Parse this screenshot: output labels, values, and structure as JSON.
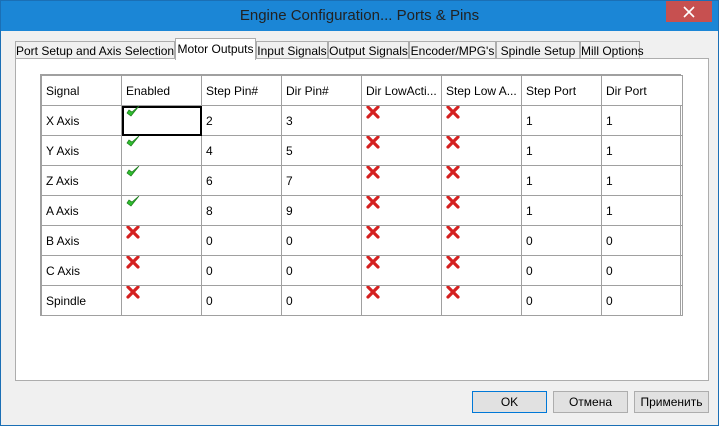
{
  "window": {
    "title": "Engine Configuration... Ports & Pins"
  },
  "tabs": [
    {
      "label": "Port Setup and Axis Selection",
      "active": false
    },
    {
      "label": "Motor Outputs",
      "active": true
    },
    {
      "label": "Input Signals",
      "active": false
    },
    {
      "label": "Output Signals",
      "active": false
    },
    {
      "label": "Encoder/MPG's",
      "active": false
    },
    {
      "label": "Spindle Setup",
      "active": false
    },
    {
      "label": "Mill Options",
      "active": false
    }
  ],
  "table": {
    "columns": [
      "Signal",
      "Enabled",
      "Step Pin#",
      "Dir Pin#",
      "Dir LowActi...",
      "Step Low A...",
      "Step Port",
      "Dir Port"
    ],
    "rows": [
      {
        "signal": "X Axis",
        "enabled": "check",
        "step_pin": "2",
        "dir_pin": "3",
        "dir_low_active": "cross",
        "step_low_active": "cross",
        "step_port": "1",
        "dir_port": "1"
      },
      {
        "signal": "Y Axis",
        "enabled": "check",
        "step_pin": "4",
        "dir_pin": "5",
        "dir_low_active": "cross",
        "step_low_active": "cross",
        "step_port": "1",
        "dir_port": "1"
      },
      {
        "signal": "Z Axis",
        "enabled": "check",
        "step_pin": "6",
        "dir_pin": "7",
        "dir_low_active": "cross",
        "step_low_active": "cross",
        "step_port": "1",
        "dir_port": "1"
      },
      {
        "signal": "A Axis",
        "enabled": "check",
        "step_pin": "8",
        "dir_pin": "9",
        "dir_low_active": "cross",
        "step_low_active": "cross",
        "step_port": "1",
        "dir_port": "1"
      },
      {
        "signal": "B Axis",
        "enabled": "cross",
        "step_pin": "0",
        "dir_pin": "0",
        "dir_low_active": "cross",
        "step_low_active": "cross",
        "step_port": "0",
        "dir_port": "0"
      },
      {
        "signal": "C Axis",
        "enabled": "cross",
        "step_pin": "0",
        "dir_pin": "0",
        "dir_low_active": "cross",
        "step_low_active": "cross",
        "step_port": "0",
        "dir_port": "0"
      },
      {
        "signal": "Spindle",
        "enabled": "cross",
        "step_pin": "0",
        "dir_pin": "0",
        "dir_low_active": "cross",
        "step_low_active": "cross",
        "step_port": "0",
        "dir_port": "0"
      }
    ]
  },
  "buttons": {
    "ok": "OK",
    "cancel": "Отмена",
    "apply": "Применить"
  },
  "colors": {
    "titlebar": "#1b86d6",
    "check": "#2fbf2f",
    "cross": "#d42020"
  },
  "icons": {
    "check": "green-check-icon",
    "cross": "red-cross-icon",
    "close": "close-icon"
  }
}
